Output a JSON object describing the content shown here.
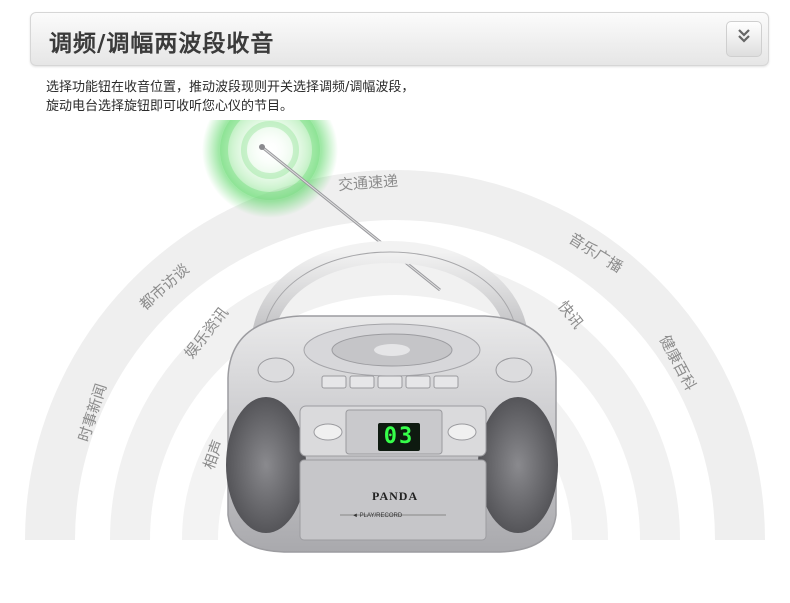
{
  "header": {
    "title": "调频/调幅两波段收音",
    "toggle_icon": "double-chevron-down-icon"
  },
  "description": {
    "line1": "选择功能钮在收音位置，推动波段现则开关选择调频/调幅波段，",
    "line2": "旋动电台选择旋钮即可收听您心仪的节目。"
  },
  "arc_labels": {
    "traffic": "交通速递",
    "music": "音乐广播",
    "city": "都市访谈",
    "entertainment": "娱乐资讯",
    "news": "时事新闻",
    "health": "健康百科",
    "xiangsheng": "相声",
    "info": "快讯"
  },
  "device": {
    "display": "03",
    "brand": "PANDA",
    "tape_label": "◄ PLAY/RECORD"
  },
  "colors": {
    "signal_green": "#4ed45a",
    "display_green": "#36ff4a",
    "arc_gray": "#e9e9e9"
  }
}
